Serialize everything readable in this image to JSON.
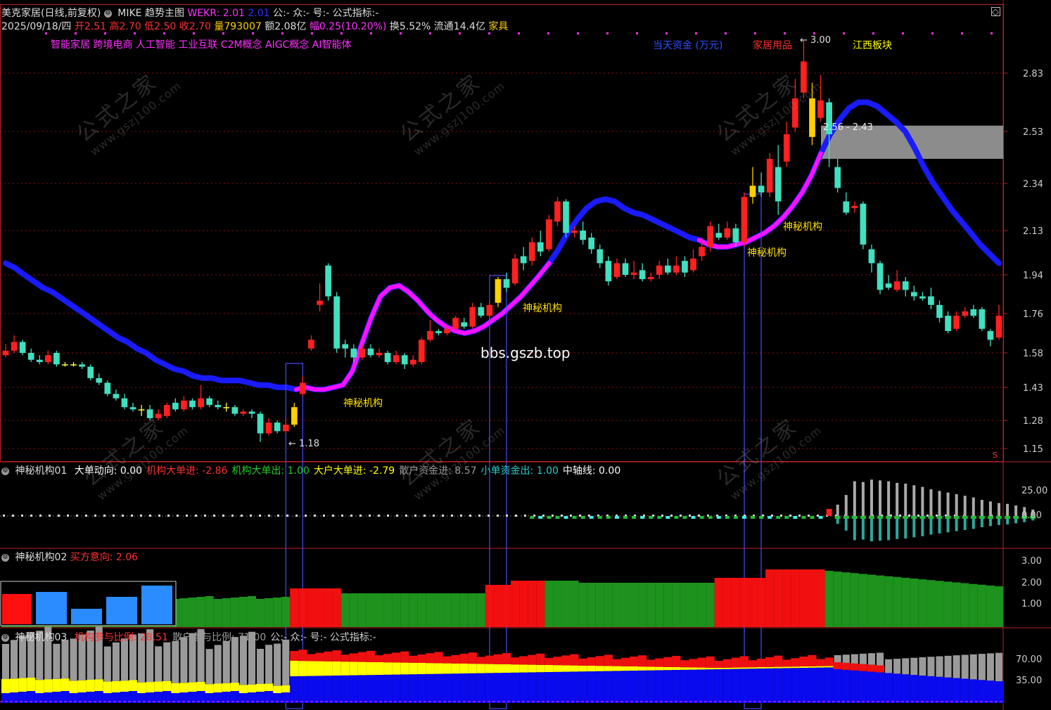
{
  "header": {
    "title": "美克家居(日线,前复权)",
    "indicator_name": "MIKE",
    "main_chart_label": "趋势主图",
    "wekr_label": "WEKR:",
    "wekr_value": "2.01",
    "wekr_value2": "2.01",
    "formula_text": "公:- 众:- 号:- 公式指标:-",
    "date": "2025/09/18/四",
    "open_label": "开",
    "open": "2.51",
    "high_label": "高",
    "high": "2.70",
    "low_label": "低",
    "low": "2.50",
    "close_label": "收",
    "close": "2.70",
    "vol_label": "量",
    "vol": "793007",
    "amount_label": "额",
    "amount": "2.08亿",
    "change_label": "幅",
    "change": "0.25(10.20%)",
    "turnover_label": "换",
    "turnover": "5.52%",
    "float_label": "流通",
    "float": "14.4亿",
    "industry": "家具"
  },
  "concepts": "智能家居 跨境电商 人工智能 工业互联 C2M概念 AIGC概念 AI智能体",
  "top_tags": {
    "capital": "当天资金 (万元)",
    "sector": "家居用品",
    "region": "江西板块"
  },
  "annotations": {
    "high_mark": "← 3.00",
    "low_mark": "← 1.18",
    "range_box": "2.56 - 2.43",
    "signal": "神秘机构",
    "site": "bbs.gszb.top",
    "s_mark": "S"
  },
  "watermark": {
    "cn": "公式之家",
    "url": "www.gszj100.com"
  },
  "panel1": {
    "name": "神秘机构01",
    "items": [
      {
        "label": "大单动向:",
        "value": "0.00",
        "color": "#ffffff"
      },
      {
        "label": "机构大单进:",
        "value": "-2.86",
        "color": "#ff3030"
      },
      {
        "label": "机构大单出:",
        "value": "1.00",
        "color": "#22cc22"
      },
      {
        "label": "大户大单进:",
        "value": "-2.79",
        "color": "#ffff00"
      },
      {
        "label": "散户资金进:",
        "value": "8.57",
        "color": "#999999"
      },
      {
        "label": "小单资金出:",
        "value": "1.00",
        "color": "#22cccc"
      },
      {
        "label": "中轴线:",
        "value": "0.00",
        "color": "#ffffff"
      }
    ],
    "ticks": [
      "25.00",
      "0.00"
    ]
  },
  "panel2": {
    "name": "神秘机构02",
    "buy_label": "买方意向:",
    "buy_value": "2.06",
    "ticks": [
      "3.00",
      "2.00",
      "1.00"
    ]
  },
  "panel3": {
    "name": "神秘机构03",
    "items": [
      {
        "label": "机构参与比例:",
        "value": "28.51",
        "color": "#ff3030"
      },
      {
        "label": "散户参与比例:",
        "value": "71.00",
        "color": "#999999"
      },
      {
        "label": "公:- 众:- 号:- 公式指标:-",
        "value": "",
        "color": "#cccccc"
      }
    ],
    "ticks": [
      "70.00",
      "35.00"
    ]
  },
  "price_ticks": [
    "2.83",
    "2.53",
    "2.34",
    "2.13",
    "1.94",
    "1.76",
    "1.58",
    "1.43",
    "1.28",
    "1.15"
  ],
  "colors": {
    "up": "#ff2020",
    "down": "#40e0c0",
    "ma_blue": "#1a1aff",
    "ma_magenta": "#ff10ff",
    "yellow": "#ffd000"
  },
  "chart_data": {
    "type": "candlestick",
    "price_axis": [
      1.15,
      2.83
    ],
    "note_high": 3.0,
    "note_low": 1.18,
    "candles": [
      [
        1.57,
        1.59,
        1.62,
        1.56
      ],
      [
        1.59,
        1.63,
        1.66,
        1.58
      ],
      [
        1.63,
        1.58,
        1.64,
        1.57
      ],
      [
        1.58,
        1.55,
        1.6,
        1.54
      ],
      [
        1.55,
        1.54,
        1.57,
        1.53
      ],
      [
        1.54,
        1.57,
        1.59,
        1.53
      ],
      [
        1.58,
        1.53,
        1.59,
        1.52
      ],
      [
        1.53,
        1.53,
        1.54,
        1.52
      ],
      [
        1.53,
        1.53,
        1.54,
        1.52
      ],
      [
        1.53,
        1.52,
        1.54,
        1.51
      ],
      [
        1.52,
        1.47,
        1.53,
        1.46
      ],
      [
        1.47,
        1.45,
        1.49,
        1.44
      ],
      [
        1.45,
        1.4,
        1.46,
        1.39
      ],
      [
        1.4,
        1.38,
        1.42,
        1.37
      ],
      [
        1.38,
        1.34,
        1.4,
        1.33
      ],
      [
        1.34,
        1.33,
        1.36,
        1.32
      ],
      [
        1.33,
        1.33,
        1.35,
        1.3
      ],
      [
        1.33,
        1.29,
        1.35,
        1.28
      ],
      [
        1.29,
        1.31,
        1.33,
        1.28
      ],
      [
        1.3,
        1.35,
        1.36,
        1.29
      ],
      [
        1.36,
        1.33,
        1.38,
        1.32
      ],
      [
        1.33,
        1.37,
        1.39,
        1.32
      ],
      [
        1.37,
        1.34,
        1.38,
        1.33
      ],
      [
        1.34,
        1.38,
        1.44,
        1.33
      ],
      [
        1.38,
        1.35,
        1.39,
        1.34
      ],
      [
        1.35,
        1.34,
        1.37,
        1.33
      ],
      [
        1.34,
        1.34,
        1.36,
        1.32
      ],
      [
        1.34,
        1.31,
        1.35,
        1.3
      ],
      [
        1.31,
        1.32,
        1.33,
        1.3
      ],
      [
        1.32,
        1.31,
        1.33,
        1.29
      ],
      [
        1.31,
        1.22,
        1.32,
        1.18
      ],
      [
        1.22,
        1.27,
        1.29,
        1.21
      ],
      [
        1.27,
        1.23,
        1.28,
        1.22
      ],
      [
        1.23,
        1.26,
        1.29,
        1.22
      ],
      [
        1.26,
        1.34,
        1.36,
        1.25
      ],
      [
        1.4,
        1.45,
        1.48,
        1.39
      ],
      [
        1.6,
        1.64,
        1.66,
        1.59
      ],
      [
        1.8,
        1.82,
        1.9,
        1.77
      ],
      [
        1.98,
        1.84,
        1.99,
        1.82
      ],
      [
        1.84,
        1.6,
        1.86,
        1.58
      ],
      [
        1.62,
        1.6,
        1.64,
        1.56
      ],
      [
        1.6,
        1.56,
        1.62,
        1.54
      ],
      [
        1.56,
        1.6,
        1.62,
        1.55
      ],
      [
        1.6,
        1.57,
        1.62,
        1.56
      ],
      [
        1.57,
        1.58,
        1.6,
        1.56
      ],
      [
        1.58,
        1.54,
        1.59,
        1.53
      ],
      [
        1.54,
        1.57,
        1.59,
        1.53
      ],
      [
        1.57,
        1.53,
        1.58,
        1.51
      ],
      [
        1.53,
        1.55,
        1.57,
        1.52
      ],
      [
        1.54,
        1.64,
        1.65,
        1.53
      ],
      [
        1.64,
        1.68,
        1.73,
        1.63
      ],
      [
        1.68,
        1.67,
        1.69,
        1.66
      ],
      [
        1.67,
        1.69,
        1.71,
        1.66
      ],
      [
        1.69,
        1.74,
        1.75,
        1.68
      ],
      [
        1.72,
        1.7,
        1.74,
        1.69
      ],
      [
        1.7,
        1.79,
        1.81,
        1.69
      ],
      [
        1.79,
        1.75,
        1.81,
        1.74
      ],
      [
        1.75,
        1.8,
        1.82,
        1.73
      ],
      [
        1.81,
        1.92,
        1.93,
        1.79
      ],
      [
        1.92,
        1.88,
        1.95,
        1.86
      ],
      [
        1.9,
        2.01,
        2.03,
        1.89
      ],
      [
        2.02,
        1.99,
        2.06,
        1.96
      ],
      [
        2.0,
        2.08,
        2.1,
        1.98
      ],
      [
        2.08,
        2.04,
        2.13,
        2.02
      ],
      [
        2.05,
        2.18,
        2.2,
        2.04
      ],
      [
        2.17,
        2.26,
        2.28,
        2.15
      ],
      [
        2.26,
        2.12,
        2.27,
        2.1
      ],
      [
        2.12,
        2.13,
        2.15,
        2.1
      ],
      [
        2.13,
        2.09,
        2.17,
        2.07
      ],
      [
        2.1,
        2.05,
        2.12,
        2.03
      ],
      [
        2.05,
        1.99,
        2.07,
        1.97
      ],
      [
        2.0,
        1.91,
        2.02,
        1.89
      ],
      [
        1.93,
        1.99,
        2.01,
        1.92
      ],
      [
        1.99,
        1.94,
        2.01,
        1.93
      ],
      [
        1.94,
        1.95,
        2.0,
        1.92
      ],
      [
        1.96,
        1.92,
        1.99,
        1.91
      ],
      [
        1.92,
        1.93,
        1.95,
        1.91
      ],
      [
        1.94,
        1.98,
        2.0,
        1.92
      ],
      [
        1.98,
        1.95,
        2.01,
        1.94
      ],
      [
        1.95,
        1.98,
        2.02,
        1.94
      ],
      [
        2.0,
        1.95,
        2.02,
        1.93
      ],
      [
        1.96,
        2.01,
        2.05,
        1.95
      ],
      [
        2.02,
        2.06,
        2.1,
        2.0
      ],
      [
        2.06,
        2.15,
        2.17,
        2.04
      ],
      [
        2.12,
        2.1,
        2.16,
        2.09
      ],
      [
        2.1,
        2.14,
        2.17,
        2.09
      ],
      [
        2.14,
        2.08,
        2.16,
        2.06
      ],
      [
        2.08,
        2.28,
        2.3,
        2.06
      ],
      [
        2.28,
        2.33,
        2.4,
        2.25
      ],
      [
        2.33,
        2.3,
        2.38,
        2.28
      ],
      [
        2.3,
        2.43,
        2.45,
        2.28
      ],
      [
        2.4,
        2.26,
        2.48,
        2.2
      ],
      [
        2.42,
        2.52,
        2.58,
        2.4
      ],
      [
        2.55,
        2.7,
        2.8,
        2.53
      ],
      [
        2.73,
        2.89,
        3.0,
        2.7
      ],
      [
        2.7,
        2.51,
        2.78,
        2.48
      ],
      [
        2.6,
        2.69,
        2.82,
        2.58
      ],
      [
        2.68,
        2.52,
        2.7,
        2.4
      ],
      [
        2.4,
        2.32,
        2.43,
        2.3
      ],
      [
        2.26,
        2.21,
        2.3,
        2.2
      ],
      [
        2.23,
        2.24,
        2.26,
        2.21
      ],
      [
        2.25,
        2.07,
        2.26,
        2.05
      ],
      [
        2.05,
        1.99,
        2.07,
        1.95
      ],
      [
        1.99,
        1.87,
        2.0,
        1.85
      ],
      [
        1.9,
        1.88,
        1.94,
        1.87
      ],
      [
        1.87,
        1.91,
        1.96,
        1.86
      ],
      [
        1.91,
        1.87,
        1.93,
        1.84
      ],
      [
        1.86,
        1.84,
        1.89,
        1.82
      ],
      [
        1.84,
        1.83,
        1.86,
        1.82
      ],
      [
        1.84,
        1.8,
        1.88,
        1.78
      ],
      [
        1.8,
        1.74,
        1.82,
        1.72
      ],
      [
        1.75,
        1.68,
        1.77,
        1.67
      ],
      [
        1.69,
        1.75,
        1.77,
        1.68
      ],
      [
        1.75,
        1.77,
        1.79,
        1.74
      ],
      [
        1.78,
        1.75,
        1.8,
        1.74
      ],
      [
        1.78,
        1.69,
        1.79,
        1.68
      ],
      [
        1.68,
        1.64,
        1.69,
        1.61
      ],
      [
        1.65,
        1.75,
        1.8,
        1.64
      ]
    ],
    "ma_line": [
      1.99,
      1.97,
      1.94,
      1.91,
      1.88,
      1.86,
      1.83,
      1.8,
      1.77,
      1.74,
      1.71,
      1.68,
      1.65,
      1.63,
      1.6,
      1.58,
      1.55,
      1.53,
      1.51,
      1.5,
      1.48,
      1.47,
      1.47,
      1.46,
      1.46,
      1.46,
      1.45,
      1.44,
      1.44,
      1.43,
      1.43,
      1.42,
      1.43,
      1.42,
      1.42,
      1.43,
      1.44,
      1.5,
      1.62,
      1.74,
      1.84,
      1.88,
      1.89,
      1.86,
      1.82,
      1.77,
      1.73,
      1.7,
      1.68,
      1.67,
      1.68,
      1.7,
      1.73,
      1.76,
      1.8,
      1.84,
      1.89,
      1.94,
      1.99,
      2.05,
      2.12,
      2.18,
      2.23,
      2.26,
      2.27,
      2.26,
      2.23,
      2.21,
      2.2,
      2.18,
      2.16,
      2.14,
      2.12,
      2.1,
      2.09,
      2.07,
      2.06,
      2.06,
      2.07,
      2.08,
      2.1,
      2.12,
      2.15,
      2.19,
      2.24,
      2.3,
      2.37,
      2.45,
      2.52,
      2.59,
      2.65,
      2.68,
      2.68,
      2.66,
      2.62,
      2.58,
      2.53,
      2.47,
      2.4,
      2.34,
      2.28,
      2.22,
      2.17,
      2.12,
      2.07,
      2.03,
      1.99
    ],
    "ma_magenta_range": [
      34,
      64
    ],
    "ma_magenta_range2": [
      82,
      96
    ],
    "signal_days": [
      34,
      58,
      88,
      95
    ],
    "range_box": [
      2.43,
      2.56
    ],
    "panel1_bars": {
      "gray_start": 98,
      "gray_values": [
        14,
        26,
        43,
        42,
        45,
        44,
        43,
        41,
        40,
        38,
        36,
        33,
        31,
        29,
        27,
        25,
        23,
        20,
        18,
        16,
        15,
        13,
        11,
        8
      ]
    },
    "panel2_values": [
      2.06
    ],
    "panel3": {
      "institution_pct": 28.51,
      "retail_pct": 71.0
    }
  }
}
